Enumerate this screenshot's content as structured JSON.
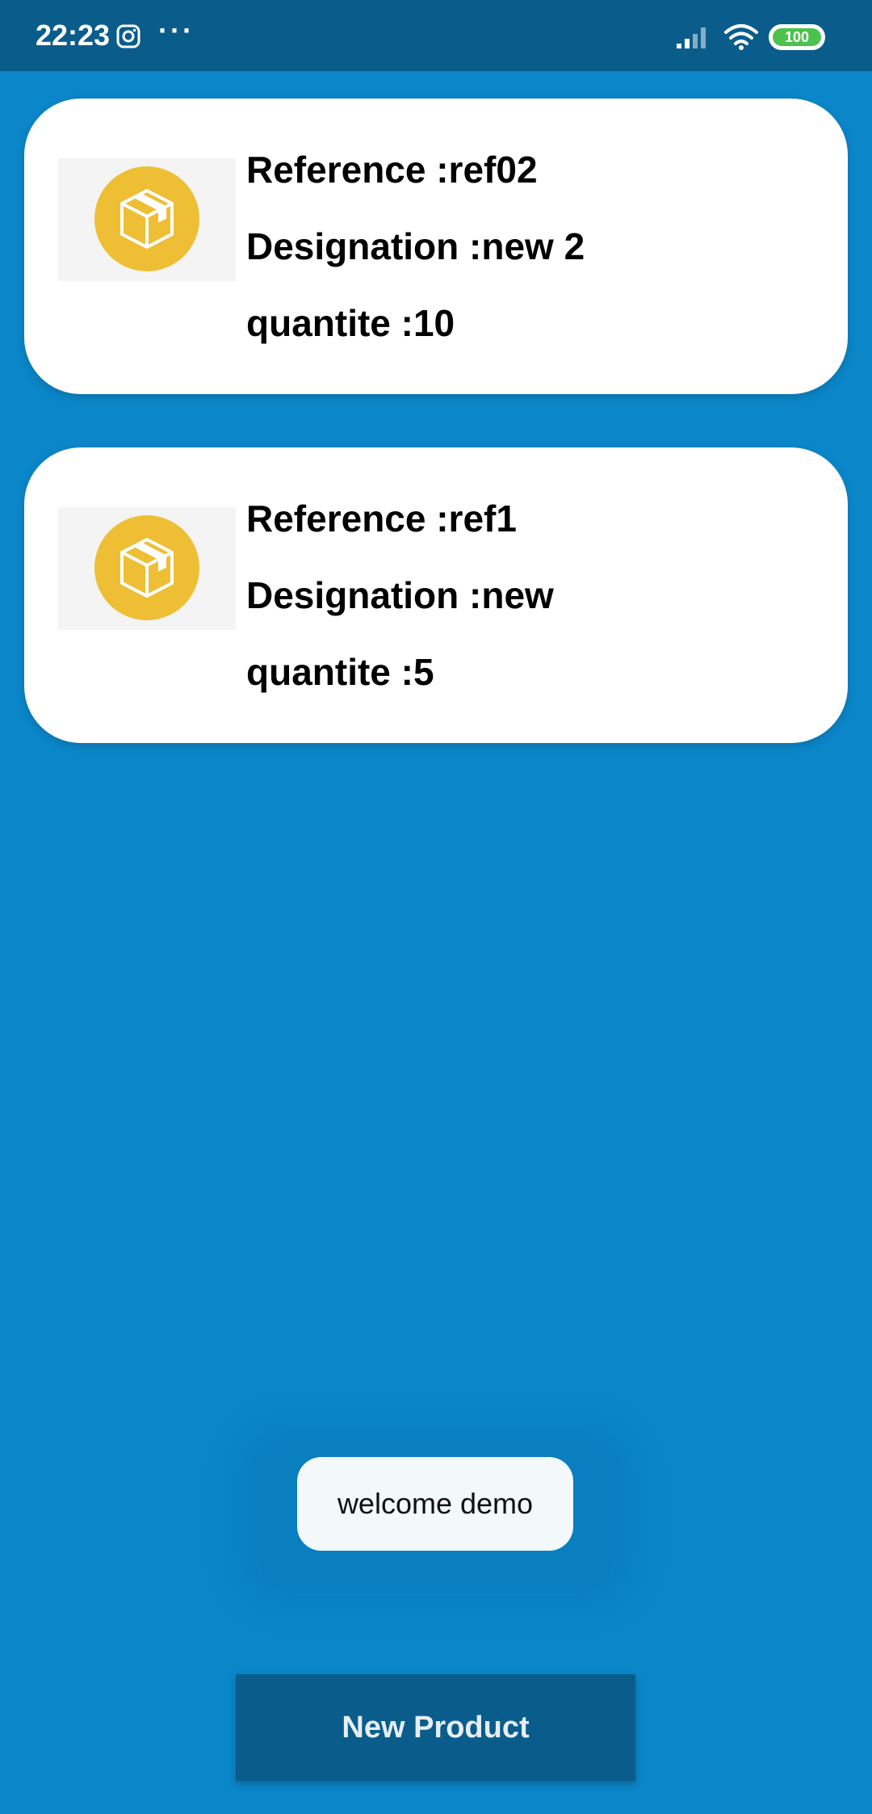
{
  "status_bar": {
    "time": "22:23",
    "dots": "···",
    "battery": "100",
    "icons": [
      "instagram-icon",
      "signal-icon",
      "wifi-icon",
      "battery-icon"
    ]
  },
  "products": [
    {
      "reference": "Reference :ref02",
      "designation": "Designation :new 2",
      "quantite": "quantite :10",
      "icon": "package-box-icon"
    },
    {
      "reference": "Reference :ref1",
      "designation": "Designation :new",
      "quantite": "quantite :5",
      "icon": "package-box-icon"
    }
  ],
  "toast": {
    "text": "welcome demo"
  },
  "new_product_button": {
    "label": "New Product"
  },
  "colors": {
    "background": "#0b86c8",
    "status_bar": "#0a5d8b",
    "card": "#ffffff",
    "icon_circle": "#eebf35",
    "button": "#0a5d8b",
    "battery": "#4cc14c"
  }
}
